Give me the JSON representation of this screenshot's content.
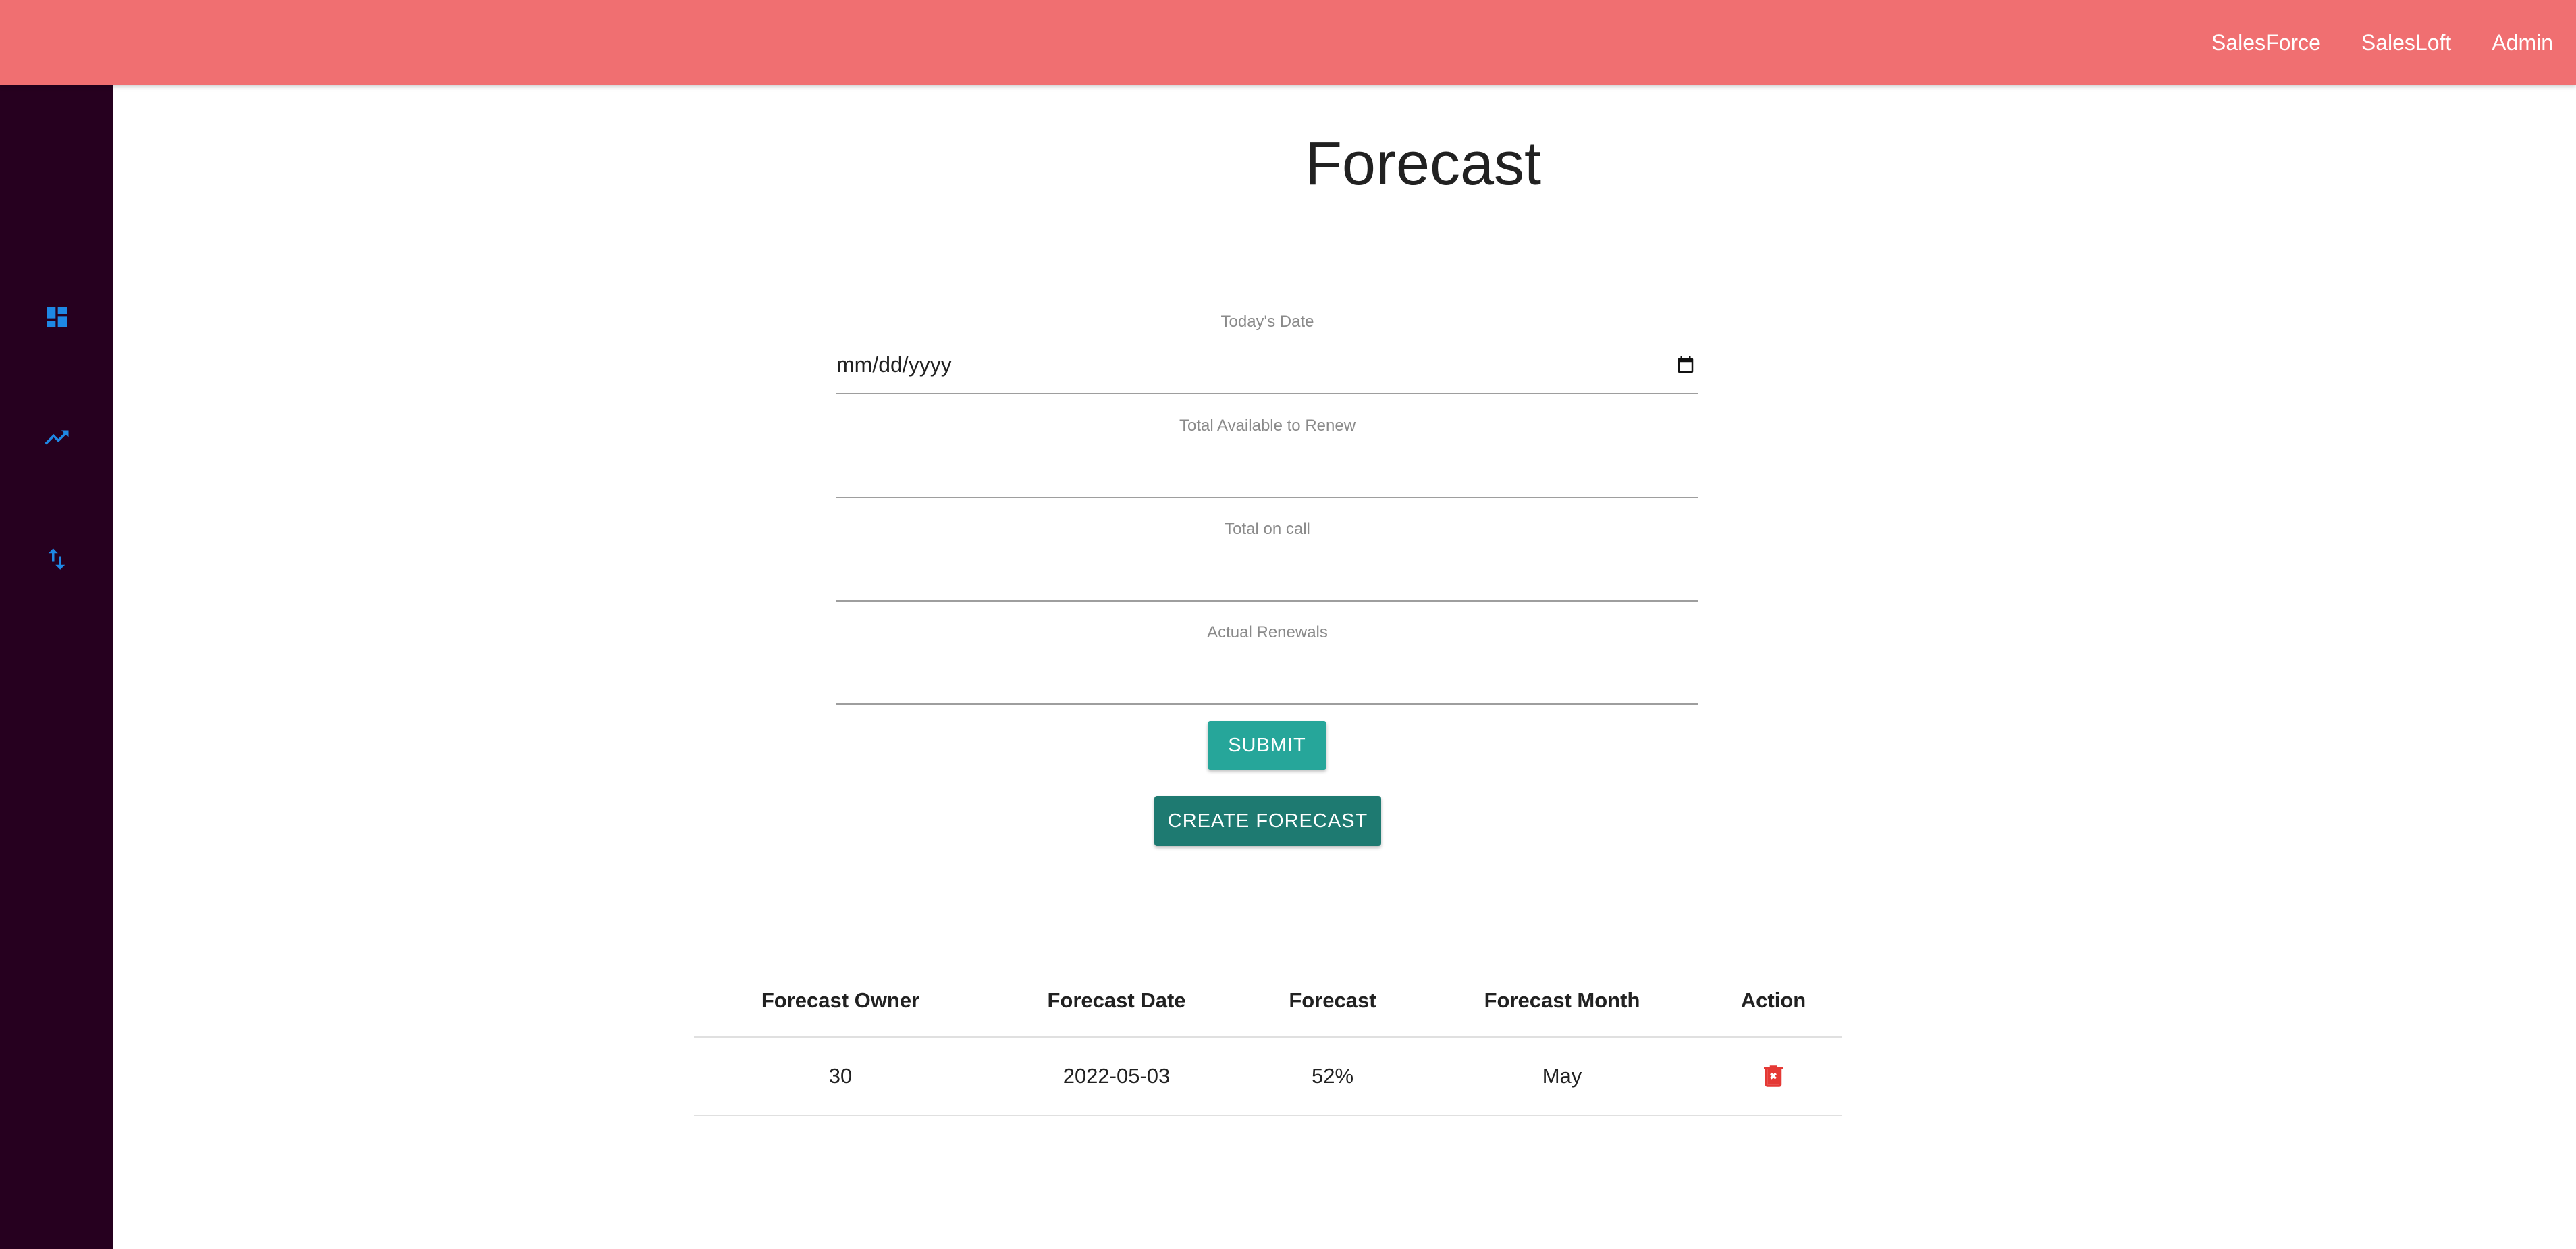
{
  "topnav": {
    "items": [
      {
        "label": "SalesForce"
      },
      {
        "label": "SalesLoft"
      },
      {
        "label": "Admin"
      }
    ]
  },
  "sidebar": {
    "icons": [
      "dashboard-icon",
      "trending-up-icon",
      "swap-vertical-icon"
    ],
    "icon_color": "#1e88e5"
  },
  "page": {
    "title": "Forecast"
  },
  "form": {
    "todays_date": {
      "label": "Today's Date",
      "value": "mm/dd/yyyy"
    },
    "total_available": {
      "label": "Total Available to Renew",
      "value": ""
    },
    "total_on_call": {
      "label": "Total on call",
      "value": ""
    },
    "actual_renewals": {
      "label": "Actual Renewals",
      "value": ""
    },
    "submit_label": "SUBMIT",
    "create_label": "CREATE FORECAST"
  },
  "table": {
    "headers": [
      "Forecast Owner",
      "Forecast Date",
      "Forecast",
      "Forecast Month",
      "Action"
    ],
    "rows": [
      {
        "owner": "30",
        "date": "2022-05-03",
        "forecast": "52%",
        "month": "May",
        "action_icon": "trash-icon"
      }
    ]
  },
  "colors": {
    "topbar": "#f06f71",
    "sidebar": "#26001f",
    "submit": "#26a69a",
    "create": "#1e7a71",
    "delete": "#e53935"
  }
}
